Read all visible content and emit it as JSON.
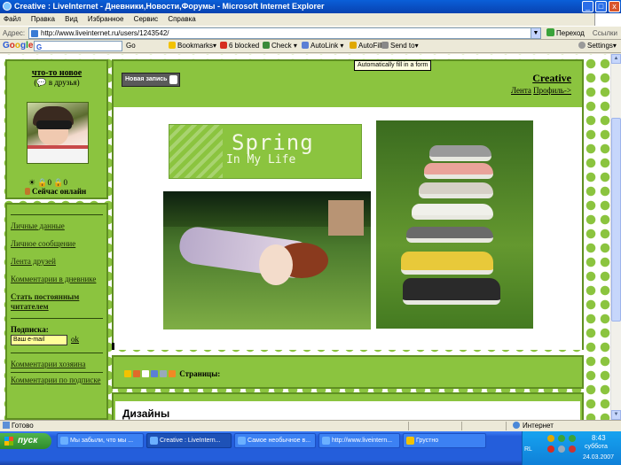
{
  "window": {
    "title": "Creative : LiveInternet - Дневники,Новости,Форумы - Microsoft Internet Explorer",
    "minimize": "_",
    "maximize": "□",
    "close": "x"
  },
  "menubar": {
    "items": [
      "Файл",
      "Правка",
      "Вид",
      "Избранное",
      "Сервис",
      "Справка"
    ]
  },
  "address_bar": {
    "label": "Адрес:",
    "url": "http://www.liveinternet.ru/users/1243542/",
    "dropdown": "▼",
    "go_label": "Переход",
    "links_label": "Ссылки"
  },
  "google_toolbar": {
    "logo_letters": [
      "G",
      "o",
      "o",
      "g",
      "l",
      "e"
    ],
    "search_prefix": "G",
    "go": "Go",
    "bookmarks": "Bookmarks▾",
    "blocked": "6 blocked",
    "check": "Check ▾",
    "autolink": "AutoLink ▾",
    "autofill": "AutoFill",
    "send_to": "Send to▾",
    "settings": "Settings▾",
    "tooltip": "Automatically fill in a form"
  },
  "sidebar": {
    "profile_name": "что-то новое",
    "add_friend": "(💬 в друзья)",
    "stats_line": "☀ 🔒0 🔒0",
    "online_status": "Сейчас онлайн",
    "links": [
      "Личные данные",
      "Личное сообщение",
      "Лента друзей",
      "Комментарии в дневнике",
      "Стать постоянным читателем"
    ],
    "subscribe_label": "Подписка:",
    "email_placeholder": "Ваш e-mail",
    "ok_label": "ok",
    "bottom_links": [
      "Комментарии хозяина",
      "Комментарии по подписке"
    ]
  },
  "header": {
    "new_post": "Новая запись",
    "blog_title": "Creative",
    "nav_feed": "Лента",
    "nav_profile": "Профиль->"
  },
  "post": {
    "banner_line1": "Spring",
    "banner_line2": "In My Life"
  },
  "pager": {
    "label": "Страницы:"
  },
  "section": {
    "title": "Дизайны"
  },
  "statusbar": {
    "status": "Готово",
    "zone": "Интернет"
  },
  "taskbar": {
    "start": "пуск",
    "tasks": [
      "Мы забыли, что мы ...",
      "Creative : LiveIntern...",
      "Самое необычное в...",
      "http://www.liveintern...",
      "Грустно"
    ],
    "tray": {
      "lang": "RL",
      "time": "8:43",
      "day": "суббота",
      "date": "24.03.2007"
    }
  },
  "colors": {
    "accent_green": "#8bc43f",
    "border_green": "#5f8f22",
    "xp_blue": "#245edb"
  }
}
